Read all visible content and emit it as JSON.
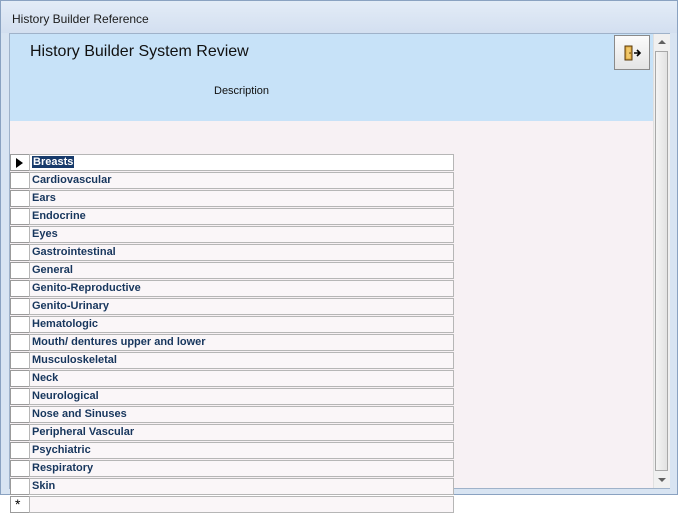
{
  "window": {
    "title": "History Builder Reference"
  },
  "form": {
    "title": "History Builder System Review",
    "column_header": "Description",
    "exit_icon": "exit-door-icon"
  },
  "rows": [
    "Breasts",
    "Cardiovascular",
    "Ears",
    "Endocrine",
    "Eyes",
    "Gastrointestinal",
    "General",
    "Genito-Reproductive",
    "Genito-Urinary",
    "Hematologic",
    "Mouth/  dentures upper and lower",
    "Musculoskeletal",
    "Neck",
    "Neurological",
    "Nose and Sinuses",
    "Peripheral Vascular",
    "Psychiatric",
    "Respiratory",
    "Skin"
  ],
  "current_row": "Breasts",
  "new_record_marker": "*",
  "colors": {
    "header": "#c7e2f8",
    "selection": "#173a6b",
    "text": "#17365d"
  }
}
